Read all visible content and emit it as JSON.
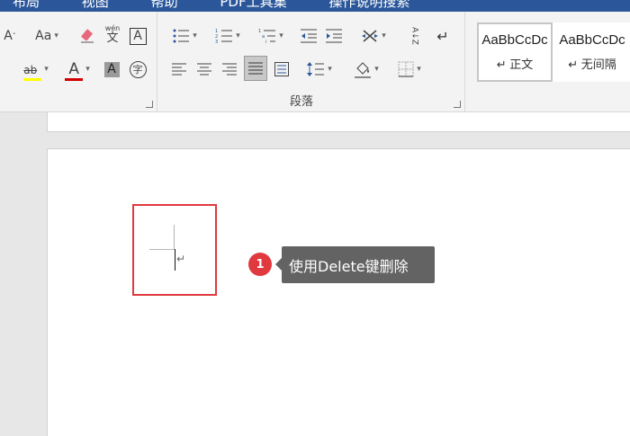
{
  "titlebar": {
    "tabs": [
      "布局",
      "视图",
      "帮助",
      "PDF工具集",
      "操作说明搜索"
    ]
  },
  "font_group": {
    "font_size_dec_glyph": "A",
    "change_case_label": "Aa",
    "phonetic_guide_top": "wén",
    "phonetic_guide_bottom": "文",
    "char_border_label": "A",
    "highlight_label": "ab",
    "font_color_label": "A",
    "char_shading_label": "A",
    "enclose_char_label": "字",
    "highlight_color": "#ffff00",
    "font_color": "#d00000"
  },
  "paragraph_group": {
    "label": "段落",
    "sort_label": "A↓Z"
  },
  "styles": [
    {
      "sample": "AaBbCcDc",
      "name": "↵ 正文"
    },
    {
      "sample": "AaBbCcDc",
      "name": "↵ 无间隔"
    }
  ],
  "document": {
    "paragraph_mark": "↵"
  },
  "annotation": {
    "step_number": "1",
    "tip_text": "使用Delete键删除",
    "highlight_color": "#e0393e"
  }
}
